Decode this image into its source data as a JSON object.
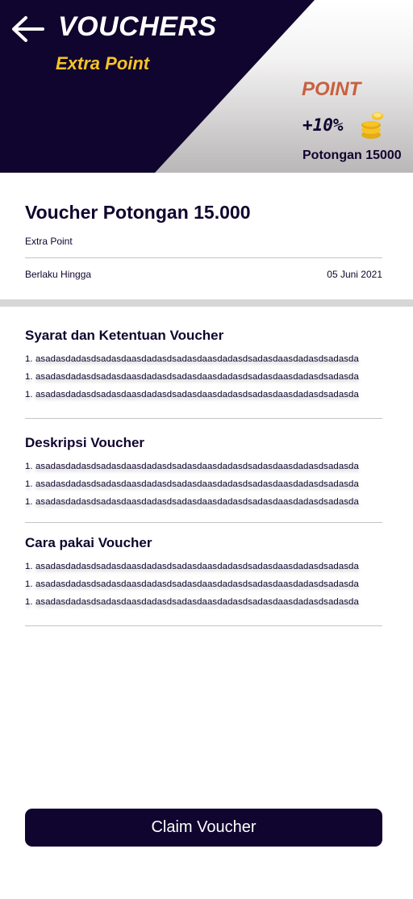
{
  "header": {
    "title": "VOUCHERS",
    "subtitle": "Extra Point",
    "point_label": "POINT",
    "point_value": "+10%",
    "discount_text": "Potongan 15000"
  },
  "voucher": {
    "name": "Voucher Potongan 15.000",
    "type": "Extra Point",
    "valid_label": "Berlaku Hingga",
    "valid_date": "05 Juni 2021"
  },
  "sections": [
    {
      "title": "Syarat dan Ketentuan Voucher",
      "items": [
        "1. asadasdadasdsadasdaasdadasdsadasdaasdadasdsadasdaasdadasdsadasda",
        "1. asadasdadasdsadasdaasdadasdsadasdaasdadasdsadasdaasdadasdsadasda",
        "1. asadasdadasdsadasdaasdadasdsadasdaasdadasdsadasdaasdadasdsadasda"
      ]
    },
    {
      "title": "Deskripsi Voucher",
      "items": [
        "1. asadasdadasdsadasdaasdadasdsadasdaasdadasdsadasdaasdadasdsadasda",
        "1. asadasdadasdsadasdaasdadasdsadasdaasdadasdsadasdaasdadasdsadasda",
        "1. asadasdadasdsadasdaasdadasdsadasdaasdadasdsadasdaasdadasdsadasda"
      ]
    },
    {
      "title": "Cara pakai Voucher",
      "items": [
        "1. asadasdadasdsadasdaasdadasdsadasdaasdadasdsadasdaasdadasdsadasda",
        "1. asadasdadasdsadasdaasdadasdsadasdaasdadasdsadasdaasdadasdsadasda",
        "1. asadasdadasdsadasdaasdadasdsadasdaasdadasdsadasdaasdadasdsadasda"
      ]
    }
  ],
  "actions": {
    "claim_label": "Claim Voucher"
  },
  "icons": {
    "back": "arrow-left-icon",
    "coins": "coins-icon"
  },
  "colors": {
    "primary": "#10052e",
    "accent_yellow": "#f7c325",
    "accent_orange": "#c9603f"
  }
}
